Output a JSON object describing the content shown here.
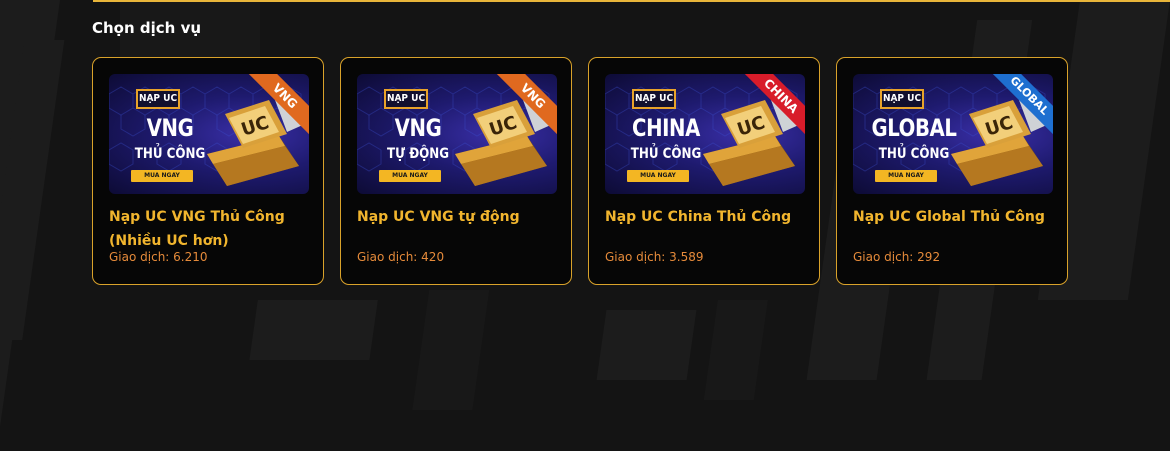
{
  "section": {
    "title": "Chọn dịch vụ"
  },
  "colors": {
    "accent": "#f1b52e",
    "stat": "#e58a3a",
    "border": "#d9a22a",
    "background": "#141414"
  },
  "cards": [
    {
      "title": "Nạp UC VNG Thủ Công (Nhiều UC hơn)",
      "stat_label": "Giao dịch:",
      "stat_value": "6.210",
      "banner": {
        "badge": "NẠP UC",
        "line1": "VNG",
        "line2": "THỦ CÔNG",
        "cta": "MUA NGAY",
        "ribbon": "VNG",
        "ribbon_color": "#e0691f"
      }
    },
    {
      "title": "Nạp UC VNG tự động",
      "stat_label": "Giao dịch:",
      "stat_value": "420",
      "banner": {
        "badge": "NẠP UC",
        "line1": "VNG",
        "line2": "TỰ ĐỘNG",
        "cta": "MUA NGAY",
        "ribbon": "VNG",
        "ribbon_color": "#e0691f"
      }
    },
    {
      "title": "Nạp UC China Thủ Công",
      "stat_label": "Giao dịch:",
      "stat_value": "3.589",
      "banner": {
        "badge": "NẠP UC",
        "line1": "CHINA",
        "line2": "THỦ CÔNG",
        "cta": "MUA NGAY",
        "ribbon": "CHINA",
        "ribbon_color": "#d81c2a"
      }
    },
    {
      "title": "Nạp UC Global Thủ Công",
      "stat_label": "Giao dịch:",
      "stat_value": "292",
      "banner": {
        "badge": "NẠP UC",
        "line1": "GLOBAL",
        "line2": "THỦ CÔNG",
        "cta": "MUA NGAY",
        "ribbon": "GLOBAL",
        "ribbon_color": "#1e6fd0"
      }
    }
  ]
}
